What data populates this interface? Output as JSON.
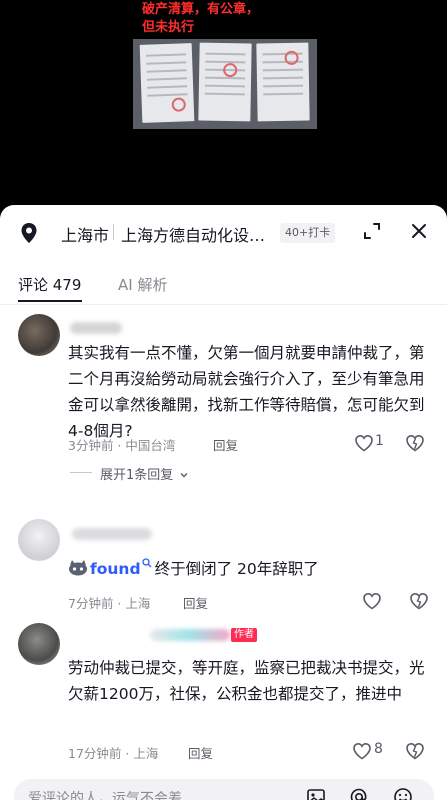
{
  "video": {
    "overlay_line1": "破产清算，有公章，",
    "overlay_line2": "但未执行"
  },
  "location": {
    "city": "上海市",
    "name": "上海方德自动化设…",
    "badge": "40+打卡"
  },
  "tabs": [
    {
      "label": "评论 479",
      "active": true
    },
    {
      "label": "AI 解析",
      "active": false
    }
  ],
  "comments": [
    {
      "text": "其实我有一点不懂，欠第一個月就要申請仲裁了，第二个月再沒給勞动局就会強行介入了，至少有筆急用金可以拿然後離開，找新工作等待賠償，怎可能欠到4-8個月?",
      "time": "3分钟前 · 中国台湾",
      "reply": "回复",
      "likes": "1",
      "expand": "展开1条回复"
    },
    {
      "prefix_name": "found",
      "text": "终于倒闭了 20年辞职了",
      "time": "7分钟前 · 上海",
      "reply": "回复",
      "likes": ""
    },
    {
      "author_tag": "作者",
      "text": "劳动仲裁已提交，等开庭，监察已把裁决书提交，光欠薪1200万，社保，公积金也都提交了，推进中",
      "time": "17分钟前 · 上海",
      "reply": "回复",
      "likes": "8"
    }
  ],
  "input": {
    "placeholder": "爱评论的人，运气不会差"
  },
  "colors": {
    "accent_red": "#fe2c55",
    "text_primary": "#161823",
    "text_secondary": "#8a8b91",
    "link_blue": "#2d5bff"
  }
}
